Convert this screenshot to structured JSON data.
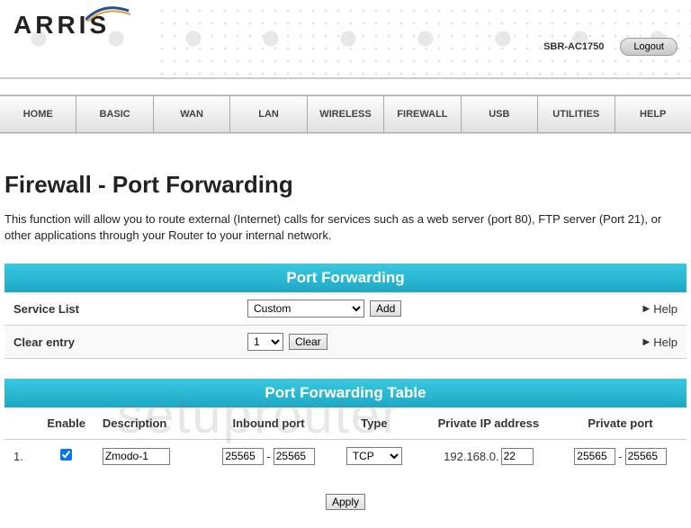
{
  "header": {
    "brand": "ARRIS",
    "model": "SBR-AC1750",
    "logout": "Logout"
  },
  "nav": [
    "HOME",
    "BASIC",
    "WAN",
    "LAN",
    "WIRELESS",
    "FIREWALL",
    "USB",
    "UTILITIES",
    "HELP"
  ],
  "page": {
    "title": "Firewall - Port Forwarding",
    "description": "This function will allow you to route external (Internet) calls for services such as a web server (port 80), FTP server (Port 21), or other applications through your Router to your internal network."
  },
  "port_forwarding": {
    "header": "Port Forwarding",
    "service_list_label": "Service List",
    "service_value": "Custom",
    "add_label": "Add",
    "clear_entry_label": "Clear entry",
    "clear_value": "1",
    "clear_label": "Clear",
    "help_label": "Help"
  },
  "table": {
    "header": "Port Forwarding Table",
    "cols": {
      "enable": "Enable",
      "description": "Description",
      "inbound": "Inbound port",
      "type": "Type",
      "privip": "Private IP address",
      "privport": "Private port"
    },
    "rows": [
      {
        "num": "1.",
        "enabled": true,
        "description": "Zmodo-1",
        "inbound_start": "25565",
        "inbound_end": "25565",
        "type": "TCP",
        "priv_ip_prefix": "192.168.0.",
        "priv_ip_last": "22",
        "priv_start": "25565",
        "priv_end": "25565"
      }
    ]
  },
  "apply_label": "Apply",
  "watermark": "setuprouter"
}
